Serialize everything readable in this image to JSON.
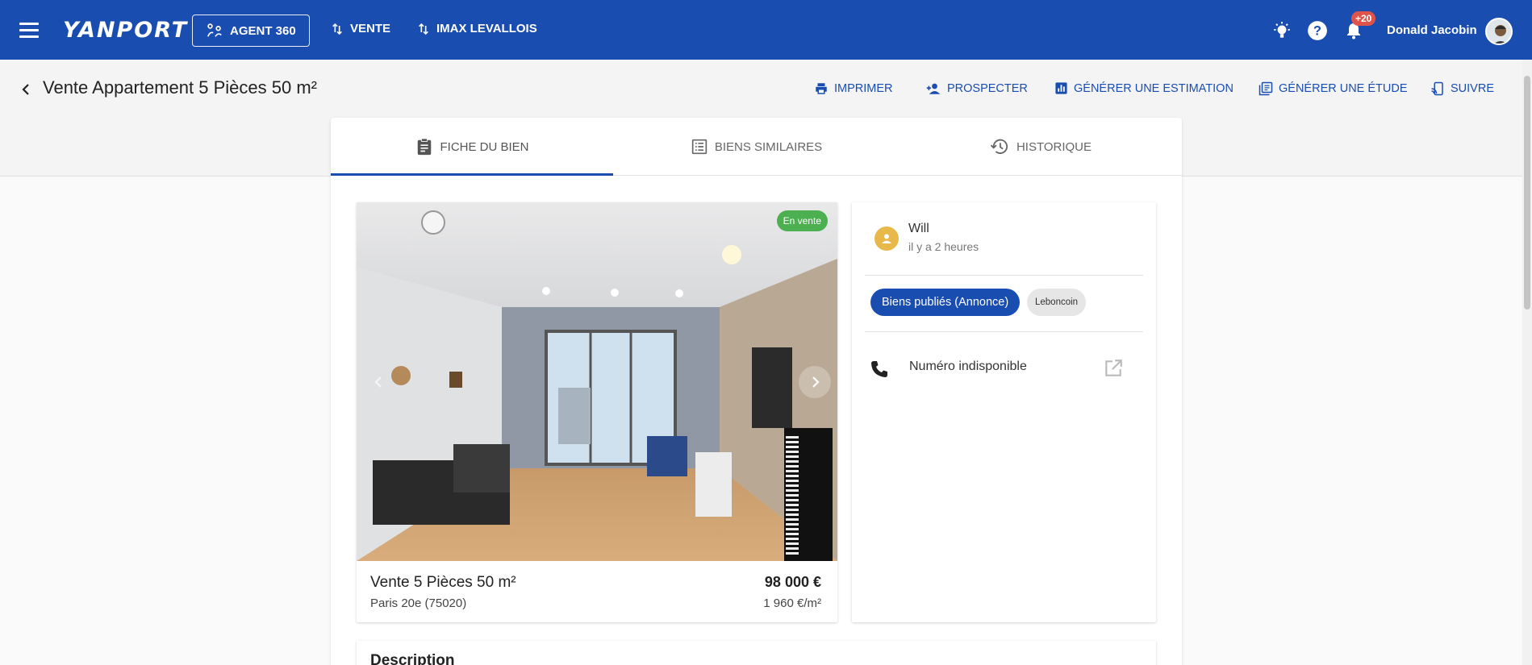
{
  "topbar": {
    "logo": "YANPORT",
    "agent_button": "AGENT 360",
    "nav_vente": "VENTE",
    "nav_imax": "IMAX LEVALLOIS",
    "notification_count": "+20",
    "user_name": "Donald Jacobin",
    "icons": [
      "menu-icon",
      "people-network-icon",
      "swap-vert-icon",
      "lightbulb-icon",
      "help-icon",
      "bell-icon"
    ]
  },
  "header": {
    "title": "Vente Appartement 5 Pièces 50 m²",
    "actions": {
      "print": "IMPRIMER",
      "prospect": "PROSPECTER",
      "estimate": "GÉNÉRER UNE ESTIMATION",
      "study": "GÉNÉRER UNE ÉTUDE",
      "follow": "SUIVRE"
    }
  },
  "tabs": [
    {
      "label": "FICHE DU BIEN",
      "active": true
    },
    {
      "label": "BIENS SIMILAIRES",
      "active": false
    },
    {
      "label": "HISTORIQUE",
      "active": false
    }
  ],
  "listing": {
    "status": "En vente",
    "title": "Vente 5 Pièces 50 m²",
    "location": "Paris 20e (75020)",
    "price": "98 000 €",
    "price_per_m2": "1 960 €/m²"
  },
  "contact": {
    "agent_name": "Will",
    "posted": "il y a 2 heures",
    "chip_primary": "Biens publiés (Annonce)",
    "chip_secondary": "Leboncoin",
    "phone": "Numéro indisponible"
  },
  "description": {
    "title": "Description"
  },
  "colors": {
    "primary": "#1a4db0",
    "status_green": "#4caf50",
    "badge_red": "#e0534a",
    "agent_avatar": "#e8b84a"
  }
}
